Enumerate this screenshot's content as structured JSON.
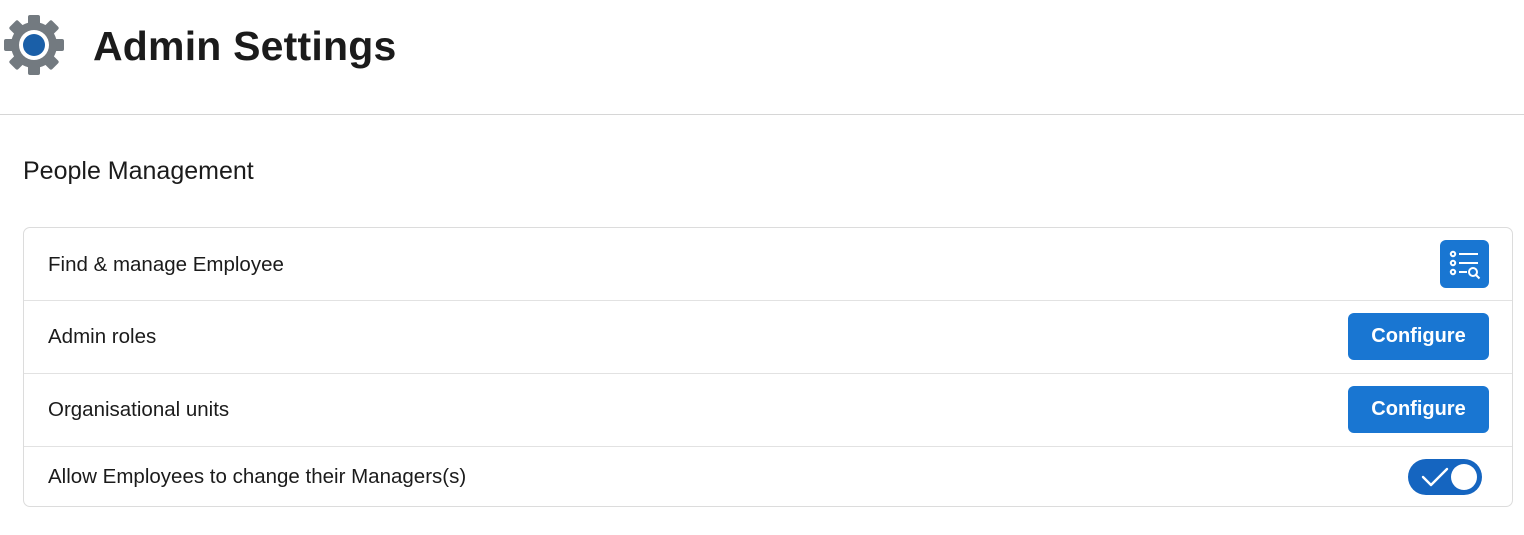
{
  "header": {
    "title": "Admin Settings",
    "icon": "gear-icon"
  },
  "section": {
    "title": "People Management"
  },
  "rows": [
    {
      "label": "Find & manage Employee",
      "action": "list-search-icon"
    },
    {
      "label": "Admin roles",
      "button_label": "Configure"
    },
    {
      "label": "Organisational units",
      "button_label": "Configure"
    },
    {
      "label": "Allow Employees to change their Managers(s)",
      "toggle_on": true
    }
  ],
  "colors": {
    "accent": "#1976d2",
    "toggle": "#1565c0",
    "gear_body": "#737a80",
    "gear_center": "#1a5fa8"
  }
}
